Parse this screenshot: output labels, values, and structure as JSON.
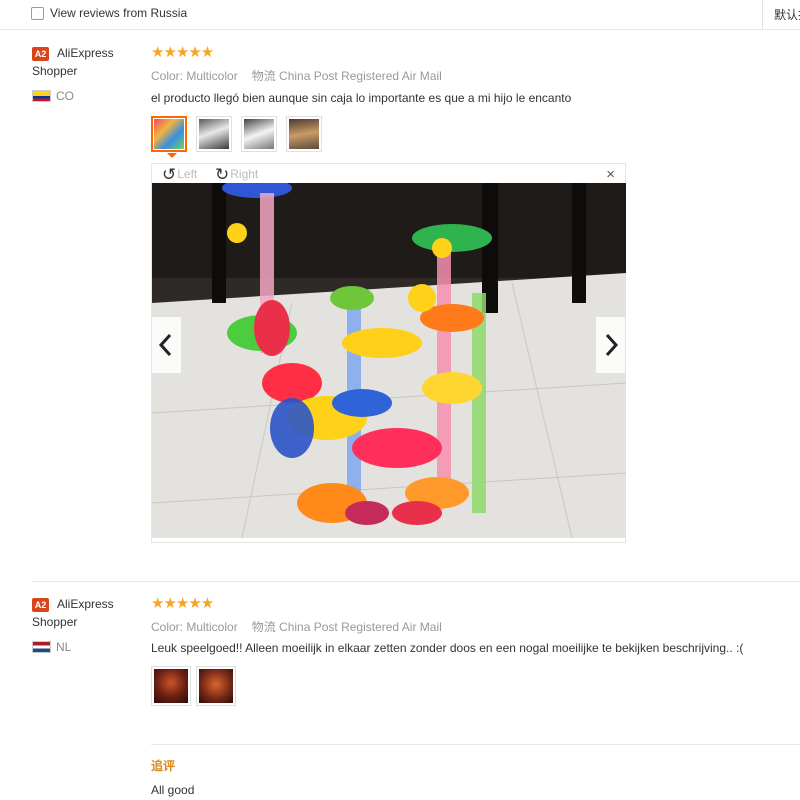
{
  "filter": {
    "checkbox_label": "View reviews from Russia",
    "sort_label": "默认排序"
  },
  "reviews": [
    {
      "badge": "A2",
      "name": "AliExpress Shopper",
      "country": "CO",
      "stars": "★★★★★",
      "color": "Color: Multicolor",
      "shipping": "物流 China Post Registered Air Mail",
      "text": "el producto llegó bien aunque sin caja lo importante es que a mi hijo le encanto",
      "viewer": {
        "rotate_left": "Left",
        "rotate_right": "Right",
        "close": "×",
        "prev": "‹",
        "next": "›"
      }
    },
    {
      "badge": "A2",
      "name": "AliExpress Shopper",
      "country": "NL",
      "stars": "★★★★★",
      "color": "Color: Multicolor",
      "shipping": "物流 China Post Registered Air Mail",
      "text": "Leuk speelgoed!! Alleen moeilijk in elkaar zetten zonder doos en een nogal moeilijke te bekijken beschrijving.. :(",
      "followup_label": "追评",
      "followup_text": "All good"
    }
  ],
  "colors": {
    "star": "#f5a623",
    "badge": "#d9451a",
    "selected_thumb": "#ff6600",
    "followup": "#d98a1c"
  },
  "icons": {
    "rotate_left": "rotate-left-icon",
    "rotate_right": "rotate-right-icon",
    "close": "close-icon",
    "prev": "chevron-left-icon",
    "next": "chevron-right-icon"
  }
}
